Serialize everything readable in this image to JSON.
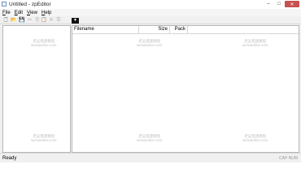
{
  "window": {
    "title": "Untitled - zpEditor"
  },
  "titlebar": {
    "min_glyph": "–",
    "max_glyph": "□",
    "close_glyph": "✕"
  },
  "menu": [
    {
      "label": "File",
      "accel": "F",
      "rest": "ile"
    },
    {
      "label": "Edit",
      "accel": "E",
      "rest": "dit"
    },
    {
      "label": "View",
      "accel": "V",
      "rest": "iew"
    },
    {
      "label": "Help",
      "accel": "H",
      "rest": "elp"
    }
  ],
  "toolbar": {
    "icons": [
      "new-file-icon",
      "open-folder-icon",
      "save-icon",
      "cut-icon",
      "copy-icon",
      "paste-icon",
      "delete-icon",
      "properties-icon",
      "dropdown-icon"
    ]
  },
  "list": {
    "columns": [
      "Filename",
      "Size",
      "Pack"
    ]
  },
  "watermark": {
    "line1": "老吴搭建教程",
    "line2": "weixiaolive.com"
  },
  "status": {
    "text": "Ready",
    "right": "CAP NUM"
  },
  "colors": {
    "close_button": "#c75050",
    "open_icon": "#d09a1a",
    "dropdown_bg": "#111111"
  }
}
